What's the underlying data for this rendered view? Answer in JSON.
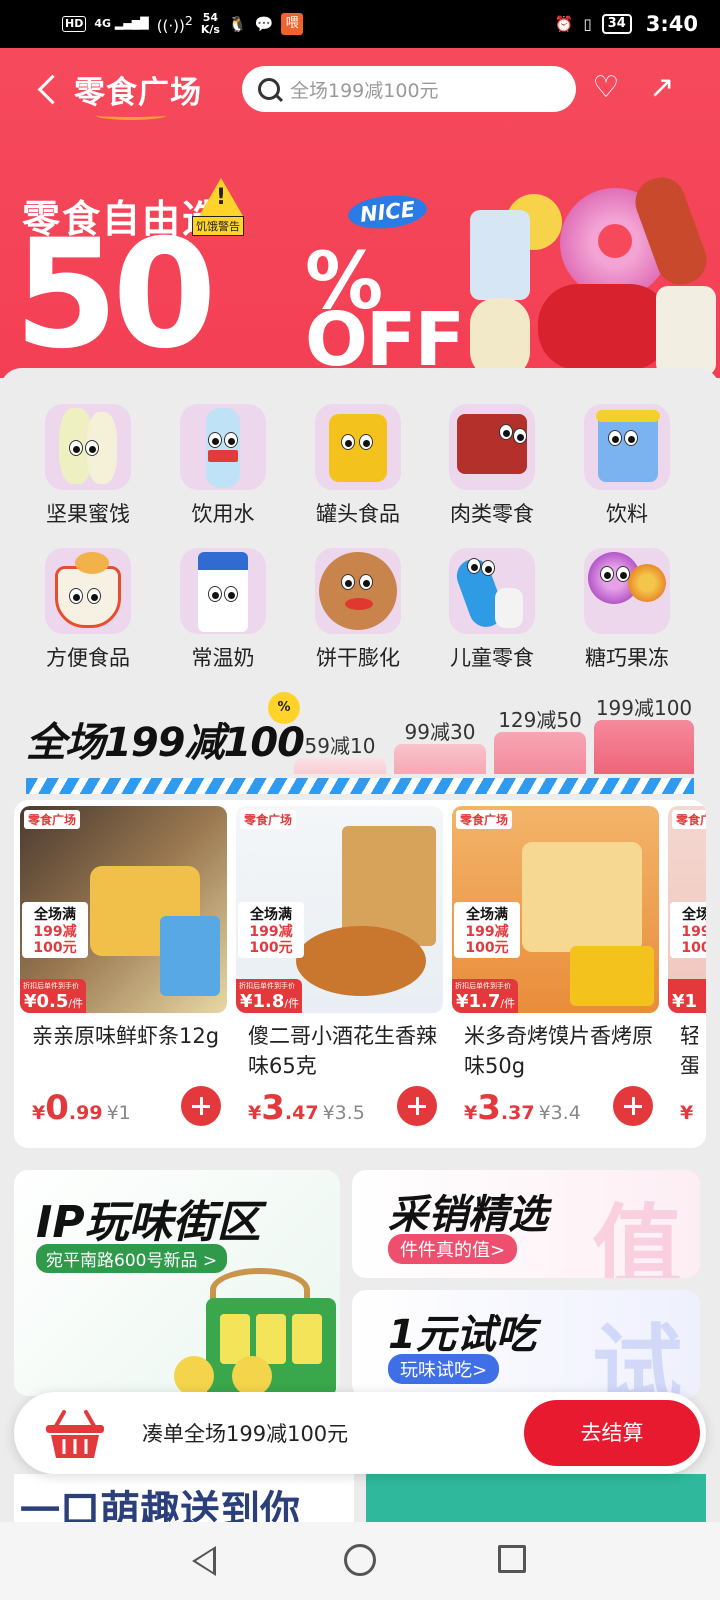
{
  "status_bar": {
    "network": "HD",
    "signal": "4G",
    "hotspot_count": "2",
    "speed_value": "54",
    "speed_unit": "K/s",
    "battery": "34",
    "time": "3:40"
  },
  "header": {
    "title": "零食广场",
    "search_placeholder": "全场199减100元"
  },
  "banner": {
    "subtitle": "零食自由选",
    "warn_label": "饥饿警告",
    "nice": "NICE",
    "big_number": "50",
    "percent": "%",
    "off": "OFF"
  },
  "categories": [
    {
      "label": "坚果蜜饯",
      "icon": "nuts-icon"
    },
    {
      "label": "饮用水",
      "icon": "water-bottle-icon"
    },
    {
      "label": "罐头食品",
      "icon": "can-icon"
    },
    {
      "label": "肉类零食",
      "icon": "meat-snack-icon"
    },
    {
      "label": "饮料",
      "icon": "drink-cup-icon"
    },
    {
      "label": "方便食品",
      "icon": "instant-noodle-icon"
    },
    {
      "label": "常温奶",
      "icon": "milk-carton-icon"
    },
    {
      "label": "饼干膨化",
      "icon": "cookie-icon"
    },
    {
      "label": "儿童零食",
      "icon": "kids-snack-icon"
    },
    {
      "label": "糖巧果冻",
      "icon": "lollipop-icon"
    }
  ],
  "promo": {
    "title": "全场199减100",
    "badge": "%",
    "tiers": [
      "59减10",
      "99减30",
      "129减50",
      "199减100"
    ]
  },
  "product_tags": {
    "shop": "零食广场",
    "promo_line1": "全场满",
    "promo_line2": "199减",
    "promo_line3": "100元",
    "price_caption": "折扣后单件到手价",
    "unit": "/件"
  },
  "products": [
    {
      "name": "亲亲原味鲜虾条12g",
      "tag_price": "0.5",
      "price_int": "0",
      "price_dec": ".99",
      "orig": "¥1"
    },
    {
      "name": "傻二哥小酒花生香辣味65克",
      "tag_price": "1.8",
      "price_int": "3",
      "price_dec": ".47",
      "orig": "¥3.5"
    },
    {
      "name": "米多奇烤馍片香烤原味50g",
      "tag_price": "1.7",
      "price_int": "3",
      "price_dec": ".37",
      "orig": "¥3.4"
    },
    {
      "name": "轻蛋",
      "tag_price": "1",
      "price_int": "",
      "price_dec": "",
      "orig": ""
    }
  ],
  "currency": "¥",
  "tiles": {
    "ip": {
      "title": "IP玩味街区",
      "sub": "宛平南路600号新品 >"
    },
    "select": {
      "title": "采销精选",
      "sub": "件件真的值>",
      "deco": "值"
    },
    "trial": {
      "title": "1元试吃",
      "sub": "玩味试吃>",
      "deco": "试"
    }
  },
  "cart": {
    "text": "凑单全场199减100元",
    "checkout": "去结算"
  },
  "under_text": "一口萌趣送到你"
}
